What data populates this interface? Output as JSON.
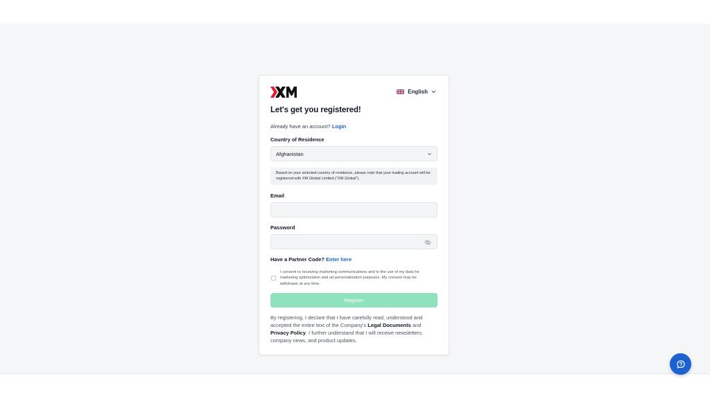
{
  "brand": {
    "name": "XM"
  },
  "language": {
    "label": "English",
    "flag": "uk-flag-icon"
  },
  "form": {
    "title": "Let's get you registered!",
    "have_account": "Already have an account?",
    "login_link": "Login",
    "country_label": "Country of Residence",
    "country_value": "Afghanistan",
    "notice": "Based on your selected country of residence, please note that your trading account will be registered with XM Global Limited (\"XM Global\").",
    "email_label": "Email",
    "email_value": "",
    "password_label": "Password",
    "password_value": "",
    "partner_prompt": "Have a Partner Code?",
    "partner_link": "Enter here",
    "consent_text": "I consent to receiving marketing communications and to the use of my data for marketing optimization and ad personalization purposes. My consent may be withdrawn at any time.",
    "consent_checked": false,
    "register_label": "Register",
    "legal": {
      "part1": "By registering, I declare that I have carefully read, understood and accepted the entire text of the Company's ",
      "legal_docs": "Legal Documents",
      "part2": " and ",
      "privacy": "Privacy Policy",
      "part3": ". I further understand that I will receive newsletters, company news, and product updates."
    }
  },
  "colors": {
    "accent_link": "#1d64c6",
    "register_disabled": "#8fe2bc",
    "chat_button": "#1c62cf"
  },
  "chat": {
    "icon": "chat-bubble-icon"
  }
}
